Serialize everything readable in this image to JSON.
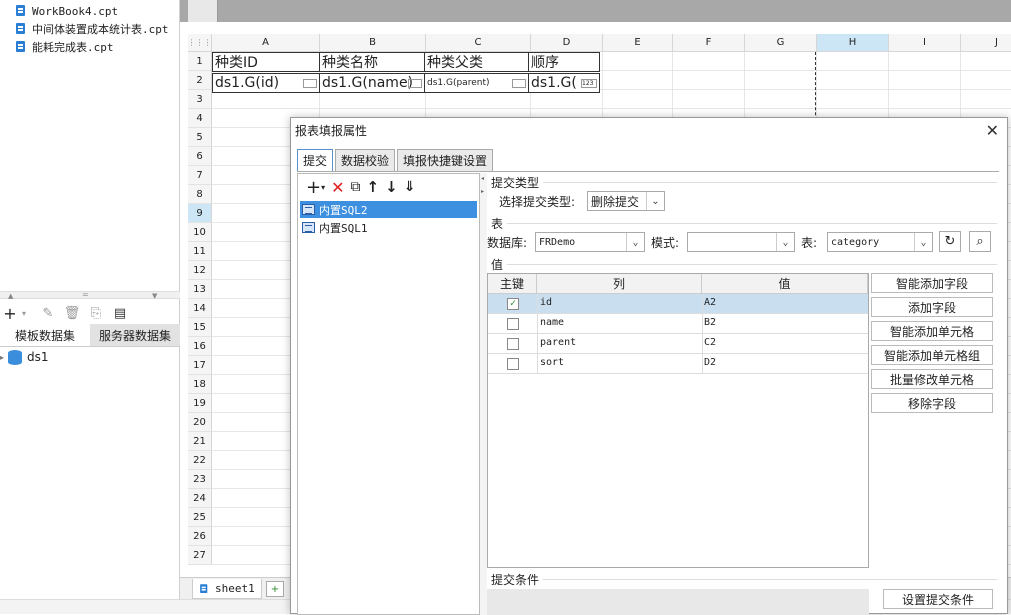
{
  "left_panel": {
    "files": [
      "WorkBook4.cpt",
      "中间体装置成本统计表.cpt",
      "能耗完成表.cpt"
    ],
    "dataset_tabs": [
      "模板数据集",
      "服务器数据集"
    ],
    "dataset_nodes": [
      "ds1"
    ],
    "toolbar_icons": [
      "add-icon",
      "edit-icon",
      "delete-icon",
      "preview-icon",
      "params-icon"
    ]
  },
  "sheet": {
    "columns": [
      "A",
      "B",
      "C",
      "D",
      "E",
      "F",
      "G",
      "H",
      "I",
      "J"
    ],
    "selected_column": "H",
    "selected_row": "9",
    "rows": [
      "1",
      "2",
      "3",
      "4",
      "5",
      "6",
      "7",
      "8",
      "9",
      "10",
      "11",
      "12",
      "13",
      "14",
      "15",
      "16",
      "17",
      "18",
      "19",
      "20",
      "21",
      "22",
      "23",
      "24",
      "25",
      "26",
      "27"
    ],
    "header_cells": [
      "种类ID",
      "种类名称",
      "种类父类",
      "顺序"
    ],
    "data_cells": [
      "ds1.G(id)",
      "ds1.G(name)",
      "ds1.G(parent)",
      "ds1.G("
    ],
    "sheet_tab": "sheet1"
  },
  "dialog": {
    "title": "报表填报属性",
    "tabs": [
      "提交",
      "数据校验",
      "填报快捷键设置"
    ],
    "submit_items": [
      "内置SQL2",
      "内置SQL1"
    ],
    "section_submit_type": "提交类型",
    "submit_type_label": "选择提交类型:",
    "submit_type_value": "删除提交",
    "section_table": "表",
    "db_label": "数据库:",
    "db_value": "FRDemo",
    "schema_label": "模式:",
    "schema_value": "",
    "table_label": "表:",
    "table_value": "category",
    "section_value": "值",
    "columns_header": [
      "主键",
      "列",
      "值"
    ],
    "rows": [
      {
        "key": true,
        "col": "id",
        "val": "A2"
      },
      {
        "key": false,
        "col": "name",
        "val": "B2"
      },
      {
        "key": false,
        "col": "parent",
        "val": "C2"
      },
      {
        "key": false,
        "col": "sort",
        "val": "D2"
      }
    ],
    "buttons": [
      "智能添加字段",
      "添加字段",
      "智能添加单元格",
      "智能添加单元格组",
      "批量修改单元格",
      "移除字段"
    ],
    "section_condition": "提交条件",
    "set_condition_button": "设置提交条件"
  }
}
